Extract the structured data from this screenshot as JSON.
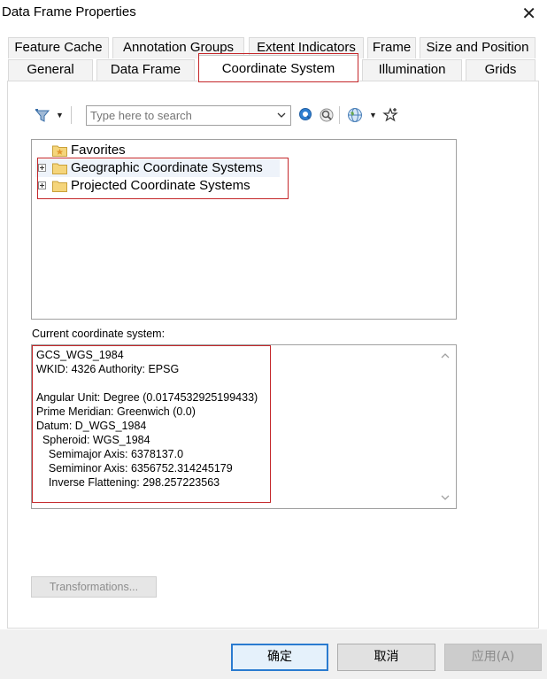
{
  "window": {
    "title": "Data Frame Properties"
  },
  "tabs_row1": [
    "Feature Cache",
    "Annotation Groups",
    "Extent Indicators",
    "Frame",
    "Size and Position"
  ],
  "tabs_row2": [
    "General",
    "Data Frame",
    "Coordinate System",
    "Illumination",
    "Grids"
  ],
  "active_tab": "Coordinate System",
  "toolbar": {
    "filter_icon": "filter-icon",
    "search_placeholder": "Type here to search",
    "search_value": "",
    "search_icon": "search-icon",
    "clear_search_icon": "clear-search-icon",
    "globe_icon": "globe-icon",
    "add_favorite_icon": "add-favorite-icon"
  },
  "tree": {
    "items": [
      {
        "label": "Favorites",
        "icon": "favorites-folder-icon",
        "expandable": false
      },
      {
        "label": "Geographic Coordinate Systems",
        "icon": "folder-icon",
        "expandable": true
      },
      {
        "label": "Projected Coordinate Systems",
        "icon": "folder-icon",
        "expandable": true
      }
    ]
  },
  "current_cs": {
    "label": "Current coordinate system:",
    "lines": [
      "GCS_WGS_1984",
      "WKID: 4326 Authority: EPSG",
      "",
      "Angular Unit: Degree (0.0174532925199433)",
      "Prime Meridian: Greenwich (0.0)",
      "Datum: D_WGS_1984",
      "  Spheroid: WGS_1984",
      "    Semimajor Axis: 6378137.0",
      "    Semiminor Axis: 6356752.314245179",
      "    Inverse Flattening: 298.257223563"
    ]
  },
  "transformations_label": "Transformations...",
  "buttons": {
    "ok": "确定",
    "cancel": "取消",
    "apply": "应用(A)"
  },
  "colors": {
    "highlight": "#c4272a",
    "ok_border": "#2a7bd0"
  }
}
